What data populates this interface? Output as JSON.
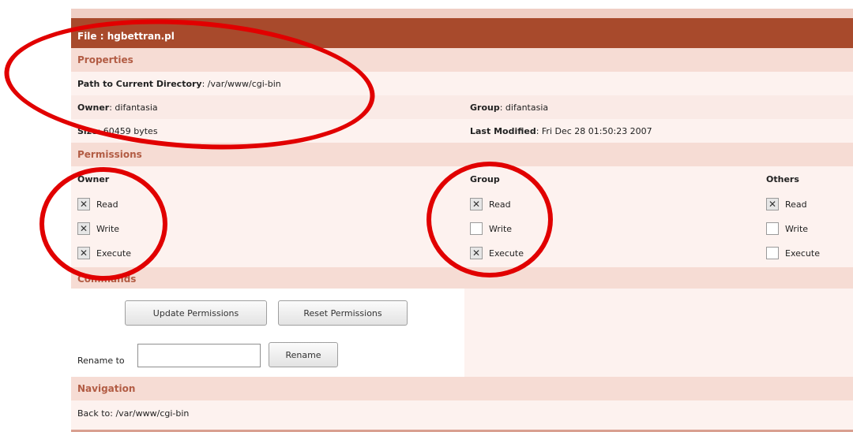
{
  "file_title": "File : hgbettran.pl",
  "sections": {
    "properties": "Properties",
    "permissions": "Permissions",
    "commands": "Commands",
    "navigation": "Navigation"
  },
  "properties": {
    "path_label": "Path to Current Directory",
    "path_value": ": /var/www/cgi-bin",
    "owner_label": "Owner",
    "owner_value": ": difantasia",
    "group_label": "Group",
    "group_value": ": difantasia",
    "size_label": "Size",
    "size_value": ": 60459 bytes",
    "modified_label": "Last Modified",
    "modified_value": ": Fri Dec 28 01:50:23 2007"
  },
  "permissions": {
    "owner": {
      "heading": "Owner",
      "read": "Read",
      "write": "Write",
      "execute": "Execute",
      "read_checked": true,
      "write_checked": true,
      "execute_checked": true
    },
    "group": {
      "heading": "Group",
      "read": "Read",
      "write": "Write",
      "execute": "Execute",
      "read_checked": true,
      "write_checked": false,
      "execute_checked": true
    },
    "others": {
      "heading": "Others",
      "read": "Read",
      "write": "Write",
      "execute": "Execute",
      "read_checked": true,
      "write_checked": false,
      "execute_checked": false
    }
  },
  "commands": {
    "update_button": "Update Permissions",
    "reset_button": "Reset Permissions",
    "rename_label": "Rename to",
    "rename_value": "",
    "rename_button": "Rename"
  },
  "navigation": {
    "back_text": "Back to: /var/www/cgi-bin"
  },
  "colors": {
    "title_bar": "#a84a2c",
    "section_header": "#f6dcd4",
    "annotation_ring": "#e10000"
  },
  "check_glyph": "✕"
}
